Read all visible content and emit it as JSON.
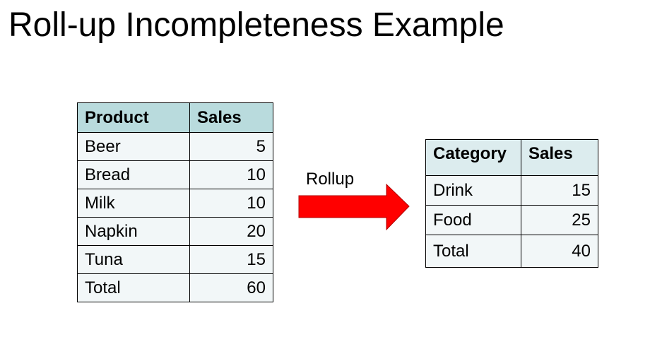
{
  "title": "Roll-up Incompleteness Example",
  "rollup_label": "Rollup",
  "arrow_color": "#ff0000",
  "left_table": {
    "headers": [
      "Product",
      "Sales"
    ],
    "rows": [
      [
        "Beer",
        "5"
      ],
      [
        "Bread",
        "10"
      ],
      [
        "Milk",
        "10"
      ],
      [
        "Napkin",
        "20"
      ],
      [
        "Tuna",
        "15"
      ],
      [
        "Total",
        "60"
      ]
    ]
  },
  "right_table": {
    "headers": [
      "Category",
      "Sales"
    ],
    "rows": [
      [
        "Drink",
        "15"
      ],
      [
        "Food",
        "25"
      ],
      [
        "Total",
        "40"
      ]
    ]
  },
  "colors": {
    "header_left": "#b9dbdd",
    "header_right": "#dcecee",
    "cell": "#f2f7f8"
  }
}
